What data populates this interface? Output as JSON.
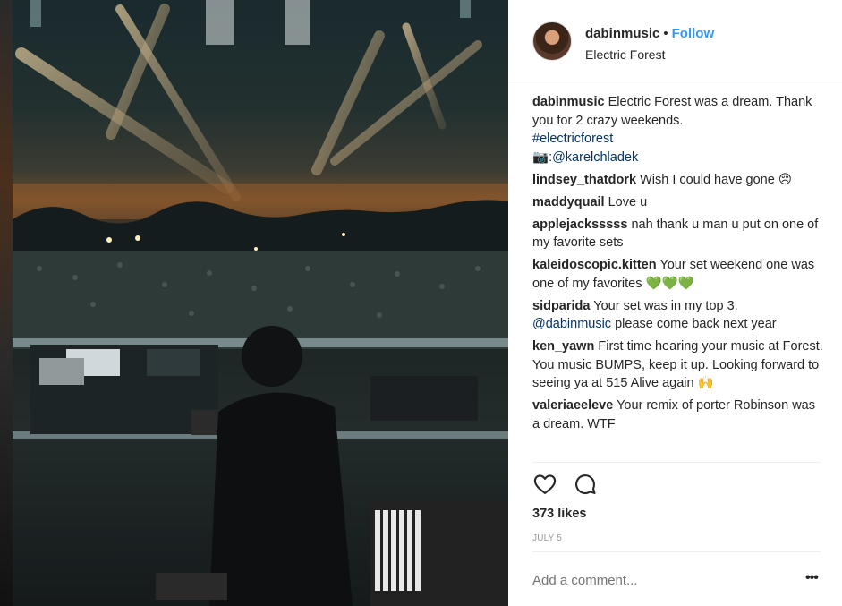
{
  "post": {
    "username": "dabinmusic",
    "separator": "•",
    "follow_label": "Follow",
    "location": "Electric Forest",
    "caption": {
      "username": "dabinmusic",
      "text": "Electric Forest was a dream. Thank you for 2 crazy weekends.",
      "hashtag": "#electricforest",
      "camera_emoji": "📷",
      "credit": ":@karelchladek"
    },
    "comments": [
      {
        "user": "lindsey_thatdork",
        "text": "Wish I could have gone",
        "emoji": "😢"
      },
      {
        "user": "maddyquail",
        "text": "Love u",
        "emoji": ""
      },
      {
        "user": "applejacksssss",
        "text": "nah thank u man u put on one of my favorite sets",
        "emoji": ""
      },
      {
        "user": "kaleidoscopic.kitten",
        "text": "Your set weekend one was one of my favorites",
        "emoji": "💚💚💚"
      },
      {
        "user": "sidparida",
        "text": "Your set was in my top 3.",
        "mention": "@dabinmusic",
        "text2": "please come back next year",
        "emoji": ""
      },
      {
        "user": "ken_yawn",
        "text": "First time hearing your music at Forest. You music BUMPS, keep it up. Looking forward to seeing ya at 515 Alive again",
        "emoji": "🙌"
      },
      {
        "user": "valeriaeeleve",
        "text": "Your remix of porter Robinson was a dream. WTF",
        "emoji": ""
      }
    ],
    "likes": "373 likes",
    "date": "JULY 5",
    "add_comment_placeholder": "Add a comment...",
    "more_label": "•••"
  },
  "icons": {
    "like": "heart-icon",
    "comment": "comment-icon",
    "more": "more-options-icon"
  },
  "colors": {
    "follow": "#3897f0",
    "link": "#003569",
    "muted": "#999999"
  }
}
